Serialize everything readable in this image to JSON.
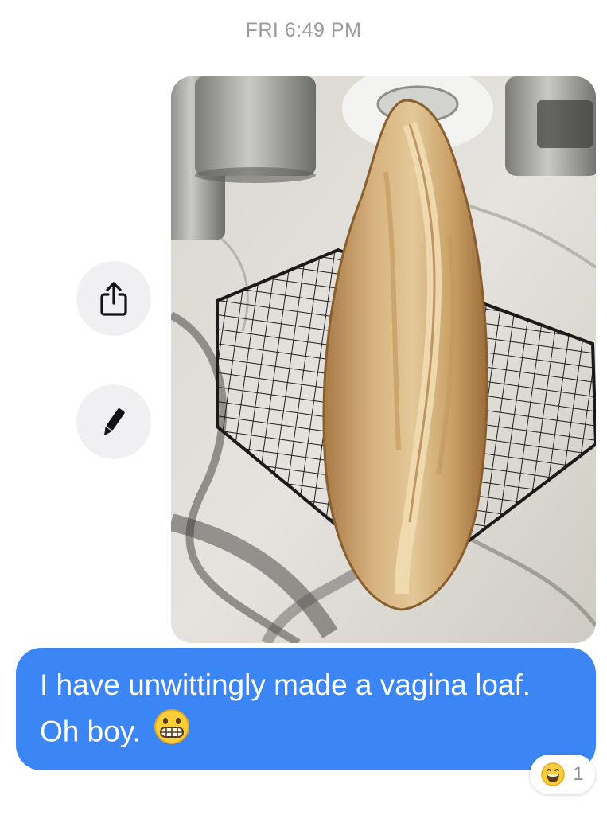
{
  "header": {
    "timestamp": "FRI 6:49 PM"
  },
  "actions": [
    {
      "icon": "share-icon"
    },
    {
      "icon": "pencil-icon"
    }
  ],
  "message": {
    "line1": "I have unwittingly made a vagina loaf.",
    "line2": "Oh boy.",
    "emoji": "grimacing-face-emoji",
    "bubble_color": "#3b86f4",
    "text_color": "#ffffff"
  },
  "reaction": {
    "icon": "laughing-face-emoji",
    "count": "1"
  }
}
